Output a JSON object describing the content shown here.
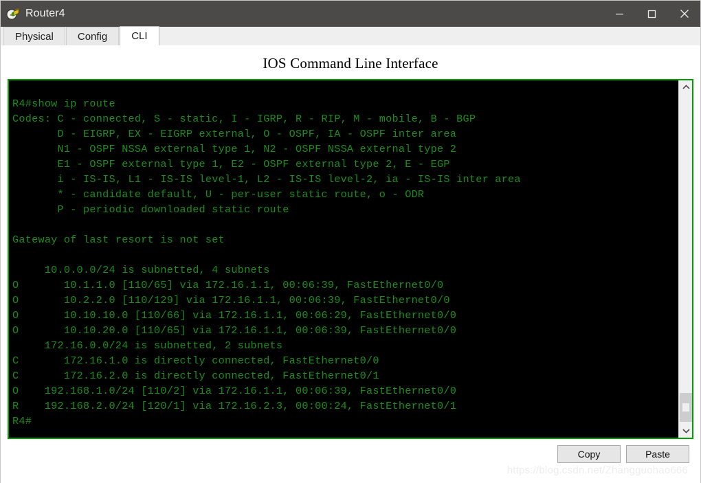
{
  "window": {
    "title": "Router4",
    "icon": "router-device-icon",
    "controls": {
      "minimize_label": "Minimize",
      "maximize_label": "Maximize",
      "close_label": "Close"
    }
  },
  "tabs": [
    {
      "label": "Physical",
      "active": false
    },
    {
      "label": "Config",
      "active": false
    },
    {
      "label": "CLI",
      "active": true
    }
  ],
  "cli": {
    "heading": "IOS Command Line Interface",
    "prompt": "R4#",
    "command": "show ip route",
    "terminal_text": "R4#show ip route\nCodes: C - connected, S - static, I - IGRP, R - RIP, M - mobile, B - BGP\n       D - EIGRP, EX - EIGRP external, O - OSPF, IA - OSPF inter area\n       N1 - OSPF NSSA external type 1, N2 - OSPF NSSA external type 2\n       E1 - OSPF external type 1, E2 - OSPF external type 2, E - EGP\n       i - IS-IS, L1 - IS-IS level-1, L2 - IS-IS level-2, ia - IS-IS inter area\n       * - candidate default, U - per-user static route, o - ODR\n       P - periodic downloaded static route\n\nGateway of last resort is not set\n\n     10.0.0.0/24 is subnetted, 4 subnets\nO       10.1.1.0 [110/65] via 172.16.1.1, 00:06:39, FastEthernet0/0\nO       10.2.2.0 [110/129] via 172.16.1.1, 00:06:39, FastEthernet0/0\nO       10.10.10.0 [110/66] via 172.16.1.1, 00:06:29, FastEthernet0/0\nO       10.10.20.0 [110/65] via 172.16.1.1, 00:06:39, FastEthernet0/0\n     172.16.0.0/24 is subnetted, 2 subnets\nC       172.16.1.0 is directly connected, FastEthernet0/0\nC       172.16.2.0 is directly connected, FastEthernet0/1\nO    192.168.1.0/24 [110/2] via 172.16.1.1, 00:06:39, FastEthernet0/0\nR    192.168.2.0/24 [120/1] via 172.16.2.3, 00:00:24, FastEthernet0/1\nR4#",
    "routing_table": {
      "gateway_of_last_resort": "Gateway of last resort is not set",
      "legend": [
        "C - connected",
        "S - static",
        "I - IGRP",
        "R - RIP",
        "M - mobile",
        "B - BGP",
        "D - EIGRP",
        "EX - EIGRP external",
        "O - OSPF",
        "IA - OSPF inter area",
        "N1 - OSPF NSSA external type 1",
        "N2 - OSPF NSSA external type 2",
        "E1 - OSPF external type 1",
        "E2 - OSPF external type 2",
        "E - EGP",
        "i - IS-IS",
        "L1 - IS-IS level-1",
        "L2 - IS-IS level-2",
        "ia - IS-IS inter area",
        "* - candidate default",
        "U - per-user static route",
        "o - ODR",
        "P - periodic downloaded static route"
      ],
      "subnet_headers": [
        "10.0.0.0/24 is subnetted, 4 subnets",
        "172.16.0.0/24 is subnetted, 2 subnets"
      ],
      "routes": [
        {
          "code": "O",
          "network": "10.1.1.0",
          "metric": "[110/65]",
          "next_hop": "172.16.1.1",
          "uptime": "00:06:39",
          "interface": "FastEthernet0/0"
        },
        {
          "code": "O",
          "network": "10.2.2.0",
          "metric": "[110/129]",
          "next_hop": "172.16.1.1",
          "uptime": "00:06:39",
          "interface": "FastEthernet0/0"
        },
        {
          "code": "O",
          "network": "10.10.10.0",
          "metric": "[110/66]",
          "next_hop": "172.16.1.1",
          "uptime": "00:06:29",
          "interface": "FastEthernet0/0"
        },
        {
          "code": "O",
          "network": "10.10.20.0",
          "metric": "[110/65]",
          "next_hop": "172.16.1.1",
          "uptime": "00:06:39",
          "interface": "FastEthernet0/0"
        },
        {
          "code": "C",
          "network": "172.16.1.0",
          "metric": "",
          "next_hop": "directly connected",
          "uptime": "",
          "interface": "FastEthernet0/0"
        },
        {
          "code": "C",
          "network": "172.16.2.0",
          "metric": "",
          "next_hop": "directly connected",
          "uptime": "",
          "interface": "FastEthernet0/1"
        },
        {
          "code": "O",
          "network": "192.168.1.0/24",
          "metric": "[110/2]",
          "next_hop": "172.16.1.1",
          "uptime": "00:06:39",
          "interface": "FastEthernet0/0"
        },
        {
          "code": "R",
          "network": "192.168.2.0/24",
          "metric": "[120/1]",
          "next_hop": "172.16.2.3",
          "uptime": "00:00:24",
          "interface": "FastEthernet0/1"
        }
      ]
    }
  },
  "scrollbar": {
    "up_arrow": "chevron-up-icon",
    "down_arrow": "chevron-down-icon"
  },
  "buttons": {
    "copy": "Copy",
    "paste": "Paste"
  },
  "watermark": "https://blog.csdn.net/Zhangguohao666",
  "colors": {
    "titlebar_bg": "#4c4a48",
    "terminal_bg": "#000000",
    "terminal_text": "#1a8f1a",
    "terminal_border": "#00a000",
    "button_bg": "#e6e6e6",
    "active_tab_bg": "#ffffff"
  }
}
